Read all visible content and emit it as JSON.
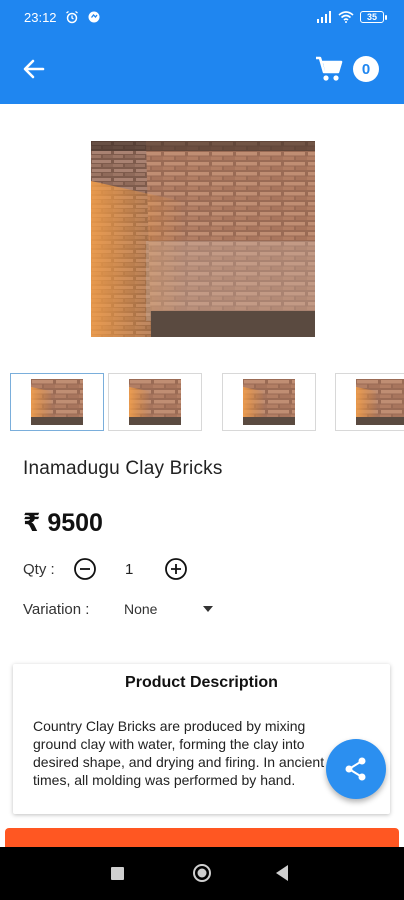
{
  "status_bar": {
    "time": "23:12",
    "battery": "35",
    "icons": [
      "alarm-icon",
      "notification-icon",
      "signal-icon",
      "wifi-icon",
      "battery-icon"
    ]
  },
  "app_bar": {
    "back_icon": "arrow-left-icon",
    "cart_icon": "cart-icon",
    "cart_count": "0",
    "accent_color": "#1f86f0"
  },
  "product": {
    "title": "Inamadugu Clay Bricks",
    "price": "₹ 9500",
    "qty_label": "Qty :",
    "qty_value": "1",
    "variation_label": "Variation :",
    "variation_value": "None"
  },
  "description": {
    "title": "Product Description",
    "lines": [
      "Country Clay Bricks are produced by mixing",
      "ground clay with water, forming the clay into",
      "desired shape, and drying and firing. In ancient",
      "times, all molding was performed by hand."
    ]
  },
  "buy_button_color": "#ff5722"
}
